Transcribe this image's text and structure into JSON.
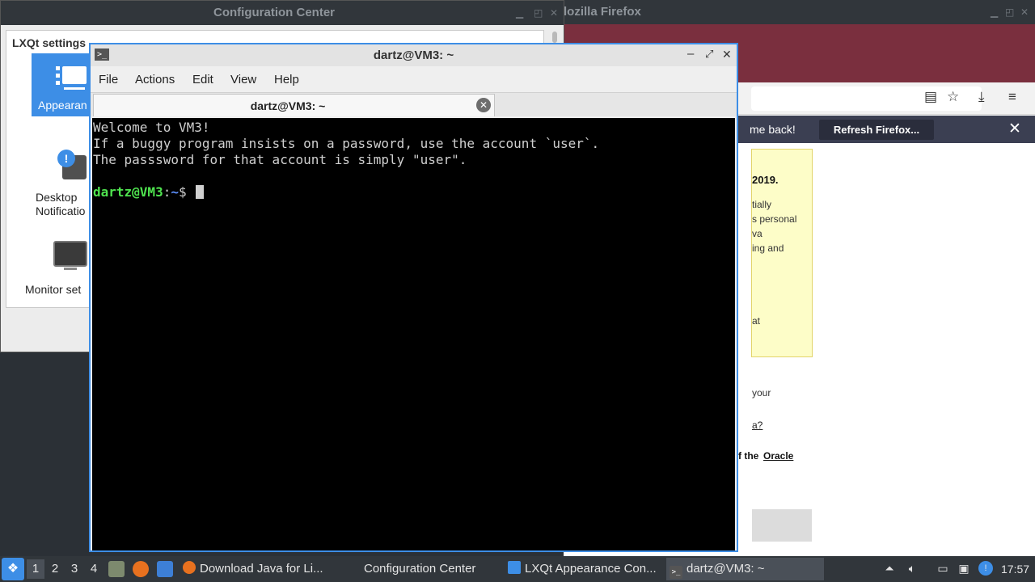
{
  "firefox": {
    "title": "Mozilla Firefox",
    "title_visible": "lozilla Firefox",
    "notification_text": "me back!",
    "refresh_label": "Refresh Firefox...",
    "date_fragment": "2019.",
    "fragments": [
      "tially",
      "s personal",
      "va",
      "ing and",
      "at",
      "your",
      "a?",
      "f the",
      "Oracle"
    ]
  },
  "config_center": {
    "title": "Configuration Center",
    "section_title": "LXQt settings",
    "items": [
      {
        "label": "Appearan",
        "icon": "appearance-icon"
      },
      {
        "label": "Desktop Notificatio",
        "icon": "notification-icon"
      },
      {
        "label": "Monitor set",
        "icon": "monitor-icon"
      }
    ]
  },
  "terminal": {
    "title": "dartz@VM3: ~",
    "menu": [
      "File",
      "Actions",
      "Edit",
      "View",
      "Help"
    ],
    "tab_label": "dartz@VM3: ~",
    "lines": [
      "Welcome to VM3!",
      "If a buggy program insists on a password, use the account `user`.",
      "The passsword for that account is simply \"user\"."
    ],
    "prompt": {
      "user": "dartz@VM3",
      "colon": ":",
      "path": "~",
      "symbol": "$"
    }
  },
  "taskbar": {
    "workspaces": [
      "1",
      "2",
      "3",
      "4"
    ],
    "active_workspace": "1",
    "tasks": [
      {
        "label": "Download Java for Li...",
        "icon": "firefox-icon"
      },
      {
        "label": "Configuration Center",
        "icon": ""
      },
      {
        "label": "LXQt Appearance Con...",
        "icon": "appearance-icon"
      },
      {
        "label": "dartz@VM3: ~",
        "icon": "terminal-icon"
      }
    ],
    "clock": "17:57"
  },
  "colors": {
    "accent": "#3d8ee6",
    "firefox_tabstrip": "#7a2f3e",
    "prompt_user": "#4fe34f",
    "prompt_path": "#5d8ffb"
  }
}
